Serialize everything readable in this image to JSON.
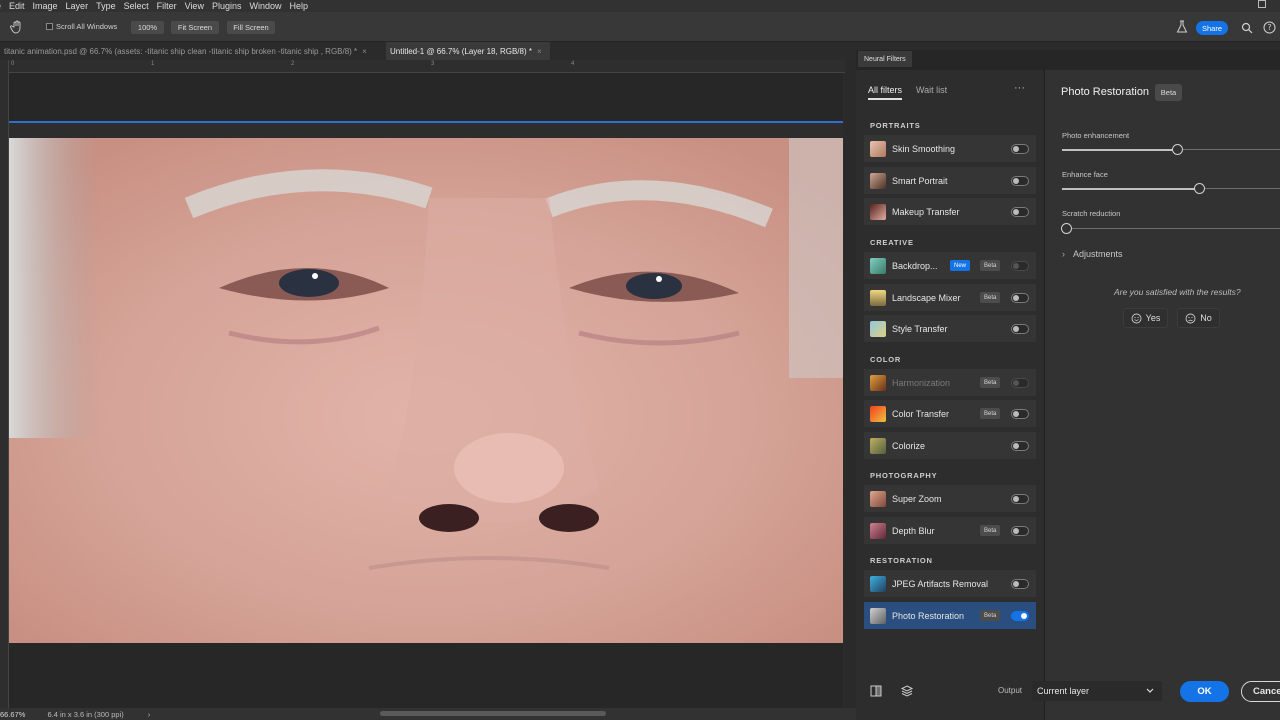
{
  "menubar": {
    "items": [
      "e",
      "Edit",
      "Image",
      "Layer",
      "Type",
      "Select",
      "Filter",
      "View",
      "Plugins",
      "Window",
      "Help"
    ]
  },
  "options": {
    "scroll_all_windows": "Scroll All Windows",
    "zoom_btn": "100%",
    "fit_screen": "Fit Screen",
    "fill_screen": "Fill Screen",
    "share": "Share"
  },
  "tabs": [
    {
      "label": "titanic animation.psd @ 66.7% (assets: -titanic ship clean -titanic ship broken -titanic ship , RGB/8) *",
      "close": "×"
    },
    {
      "label": "Untitled-1 @ 66.7% (Layer 18, RGB/8) *",
      "close": "×"
    }
  ],
  "ruler": {
    "ticks": [
      "0",
      "1",
      "2",
      "3",
      "4"
    ]
  },
  "status": {
    "zoom": "66.67%",
    "doc_size": "6.4 in x 3.6 in (300 ppi)",
    "arrow": "›"
  },
  "neural": {
    "panel_tab": "Neural Filters",
    "tab_all": "All filters",
    "tab_wait": "Wait list",
    "more": "···",
    "categories": {
      "portraits": "PORTRAITS",
      "creative": "CREATIVE",
      "color": "COLOR",
      "photography": "PHOTOGRAPHY",
      "restoration": "RESTORATION"
    },
    "filters": {
      "skin": "Skin Smoothing",
      "smart": "Smart Portrait",
      "makeup": "Makeup Transfer",
      "backdrop": "Backdrop...",
      "landscape": "Landscape Mixer",
      "style": "Style Transfer",
      "harmonization": "Harmonization",
      "color_transfer": "Color Transfer",
      "colorize": "Colorize",
      "super_zoom": "Super Zoom",
      "depth_blur": "Depth Blur",
      "jpeg": "JPEG Artifacts Removal",
      "photo_restoration": "Photo Restoration"
    },
    "badge_new": "New",
    "badge_beta": "Beta",
    "settings": {
      "title": "Photo Restoration",
      "beta": "Beta",
      "photo_enhancement": "Photo enhancement",
      "enhance_face": "Enhance face",
      "scratch_reduction": "Scratch reduction",
      "adjustments": "Adjustments",
      "adjustments_chevron": "›",
      "question": "Are you satisfied with the results?",
      "yes": "Yes",
      "no": "No",
      "photo_enhancement_level": 0.54,
      "enhance_face_level": 0.64,
      "scratch_reduction_level": 0.0
    },
    "output_label": "Output",
    "output_value": "Current layer",
    "ok": "OK",
    "cancel": "Cance"
  },
  "colors": {
    "accent": "#1473e6",
    "selected_row": "#2a4e7f"
  }
}
